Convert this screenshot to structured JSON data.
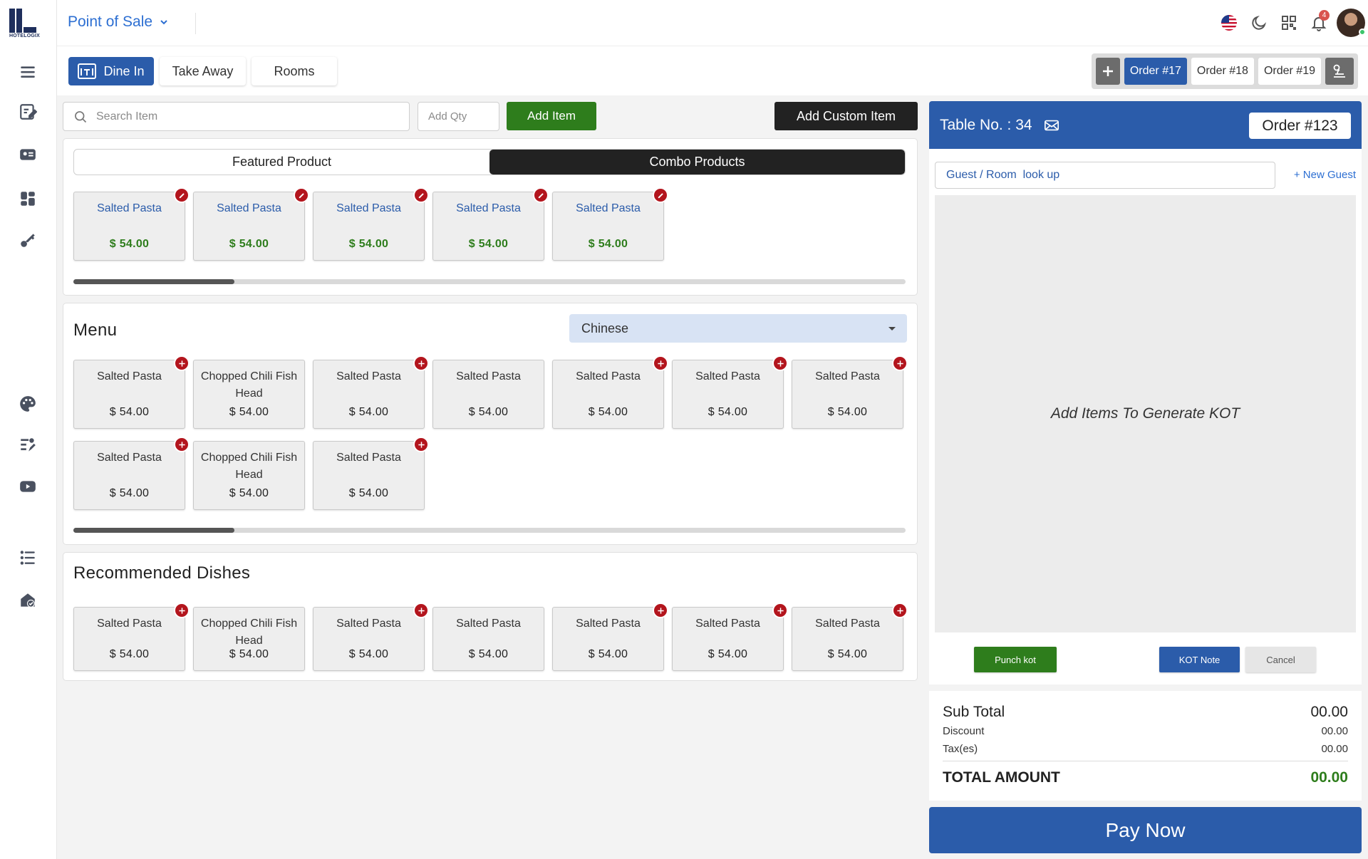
{
  "app": {
    "logo_text": "HOTELOGIX",
    "title": "Point of Sale"
  },
  "sidebar": {
    "icons": [
      "menu-icon",
      "edit-note-icon",
      "id-card-icon",
      "dashboard-icon",
      "key-icon",
      "palette-icon",
      "recipe-icon",
      "youtube-icon",
      "list-icon",
      "shield-check-icon"
    ]
  },
  "topbar": {
    "notification_count": "4",
    "icons": [
      "us-flag-icon",
      "moon-icon",
      "qr-grid-icon",
      "bell-icon"
    ]
  },
  "order_types": {
    "dine_in": "Dine In",
    "take_away": "Take Away",
    "rooms": "Rooms"
  },
  "orders": {
    "tabs": [
      "Order #17",
      "Order #18",
      "Order #19"
    ],
    "active_index": 0
  },
  "search": {
    "item_placeholder": "Search Item",
    "qty_placeholder": "Add Qty",
    "add_item_label": "Add Item",
    "add_custom_label": "Add Custom Item"
  },
  "featured": {
    "tabs": [
      "Featured Product",
      "Combo Products"
    ],
    "active_tab": 1,
    "items": [
      {
        "name": "Salted Pasta",
        "price": "$ 54.00"
      },
      {
        "name": "Salted Pasta",
        "price": "$ 54.00"
      },
      {
        "name": "Salted Pasta",
        "price": "$ 54.00"
      },
      {
        "name": "Salted Pasta",
        "price": "$ 54.00"
      },
      {
        "name": "Salted Pasta",
        "price": "$ 54.00"
      }
    ],
    "scroll_fraction": 0.19
  },
  "menu": {
    "title": "Menu",
    "category": "Chinese",
    "items": [
      {
        "name": "Salted Pasta",
        "price": "$ 54.00",
        "badge": true
      },
      {
        "name": "Chopped Chili Fish Head",
        "price": "$ 54.00",
        "badge": false
      },
      {
        "name": "Salted Pasta",
        "price": "$ 54.00",
        "badge": true
      },
      {
        "name": "Salted Pasta",
        "price": "$ 54.00",
        "badge": false
      },
      {
        "name": "Salted Pasta",
        "price": "$ 54.00",
        "badge": true
      },
      {
        "name": "Salted Pasta",
        "price": "$ 54.00",
        "badge": true
      },
      {
        "name": "Salted Pasta",
        "price": "$ 54.00",
        "badge": true
      },
      {
        "name": "Salted Pasta",
        "price": "$ 54.00",
        "badge": true
      },
      {
        "name": "Chopped Chili Fish Head",
        "price": "$ 54.00",
        "badge": false
      },
      {
        "name": "Salted Pasta",
        "price": "$ 54.00",
        "badge": true
      }
    ],
    "scroll_fraction": 0.19
  },
  "recommended": {
    "title": "Recommended Dishes",
    "items": [
      {
        "name": "Salted Pasta",
        "price": "$ 54.00",
        "badge": true
      },
      {
        "name": "Chopped Chili Fish Head",
        "price": "$ 54.00",
        "badge": false
      },
      {
        "name": "Salted Pasta",
        "price": "$ 54.00",
        "badge": true
      },
      {
        "name": "Salted Pasta",
        "price": "$ 54.00",
        "badge": false
      },
      {
        "name": "Salted Pasta",
        "price": "$ 54.00",
        "badge": true
      },
      {
        "name": "Salted Pasta",
        "price": "$ 54.00",
        "badge": true
      },
      {
        "name": "Salted Pasta",
        "price": "$ 54.00",
        "badge": true
      }
    ]
  },
  "order_panel": {
    "table_label": "Table No. : 34",
    "order_label": "Order #123",
    "guest_placeholder": "Guest / Room  look up",
    "new_guest_label": "+ New Guest",
    "empty_message": "Add Items To Generate KOT",
    "punch_kot_label": "Punch kot",
    "kot_note_label": "KOT Note",
    "cancel_label": "Cancel"
  },
  "summary": {
    "sub_total_label": "Sub Total",
    "sub_total_value": "00.00",
    "discount_label": "Discount",
    "discount_value": "00.00",
    "tax_label": "Tax(es)",
    "tax_value": "00.00",
    "total_label": "TOTAL AMOUNT",
    "total_value": "00.00",
    "pay_now_label": "Pay Now"
  },
  "colors": {
    "primary": "#2b5caa",
    "success": "#2e7d1c",
    "danger": "#b3151d",
    "dark": "#222222"
  }
}
